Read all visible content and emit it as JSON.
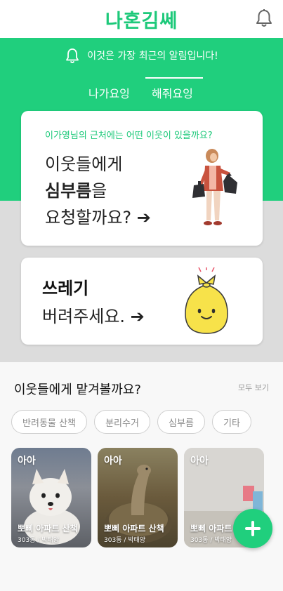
{
  "header": {
    "logo": "나혼김쎄",
    "bell_icon": "bell-icon"
  },
  "notice": {
    "text": "이것은 가장 최근의 알림입니다!",
    "icon": "bell-icon"
  },
  "tabs": [
    {
      "label": "나가요잉",
      "active": false
    },
    {
      "label": "해줘요잉",
      "active": true
    }
  ],
  "errand_card": {
    "subtitle": "이가영님의 근처에는 어떤 이웃이 있을까요?",
    "line1": "이웃들에게",
    "line2_bold": "심부름",
    "line2_rest": "을",
    "line3": "요청할까요? ➔",
    "illustration": "person-with-trash-bags"
  },
  "trash_card": {
    "title": "쓰레기",
    "subtitle": "버려주세요. ➔",
    "illustration": "smiling-trash-bag"
  },
  "section": {
    "title": "이웃들에게 맡겨볼까요?",
    "see_all": "모두 보기"
  },
  "categories": [
    "반려동물 산책",
    "분리수거",
    "심부름",
    "기타"
  ],
  "posts": [
    {
      "tag": "아아",
      "title": "뽀삐 아파트 산책",
      "meta": "303동 / 박태양",
      "image": "white puppy"
    },
    {
      "tag": "아아",
      "title": "뽀삐 아파트 산책",
      "meta": "303동 / 박태양",
      "image": "tortoise"
    },
    {
      "tag": "아아",
      "title": "뽀삐 아파트 산책",
      "meta": "303동 / 박태양",
      "image": "room"
    }
  ],
  "fab": {
    "icon": "plus-icon"
  },
  "colors": {
    "brand": "#20cf7d",
    "brand_text": "#1dc97a",
    "grey_band": "#dcdcdc"
  }
}
